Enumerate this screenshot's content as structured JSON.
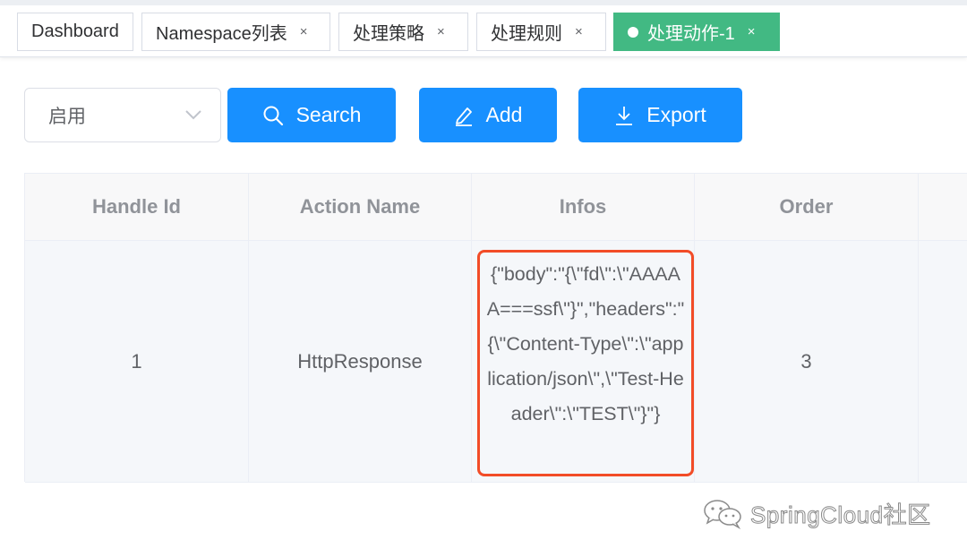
{
  "tabs": [
    {
      "label": "Dashboard",
      "closable": false,
      "active": false
    },
    {
      "label": "Namespace列表",
      "closable": true,
      "active": false
    },
    {
      "label": "处理策略",
      "closable": true,
      "active": false
    },
    {
      "label": "处理规则",
      "closable": true,
      "active": false
    },
    {
      "label": "处理动作-1",
      "closable": true,
      "active": true
    }
  ],
  "close_glyph": "×",
  "toolbar": {
    "status_select_value": "启用",
    "search_label": "Search",
    "add_label": "Add",
    "export_label": "Export"
  },
  "table": {
    "columns": [
      "Handle Id",
      "Action Name",
      "Infos",
      "Order"
    ],
    "rows": [
      {
        "handle_id": "1",
        "action_name": "HttpResponse",
        "infos": "{\"body\":\"{\\\"fd\\\":\\\"AAAAA===ssf\\\"}\",\"headers\":\"{\\\"Content-Type\\\":\\\"application/json\\\",\\\"Test-Header\\\":\\\"TEST\\\"}\"}",
        "order": "3"
      }
    ]
  },
  "watermark": "SpringCloud社区",
  "colors": {
    "primary": "#1890ff",
    "active_tab": "#42b983",
    "highlight_border": "#f24c27"
  },
  "icons": [
    "search-icon",
    "edit-icon",
    "download-icon",
    "chevron-down-icon",
    "wechat-icon"
  ]
}
